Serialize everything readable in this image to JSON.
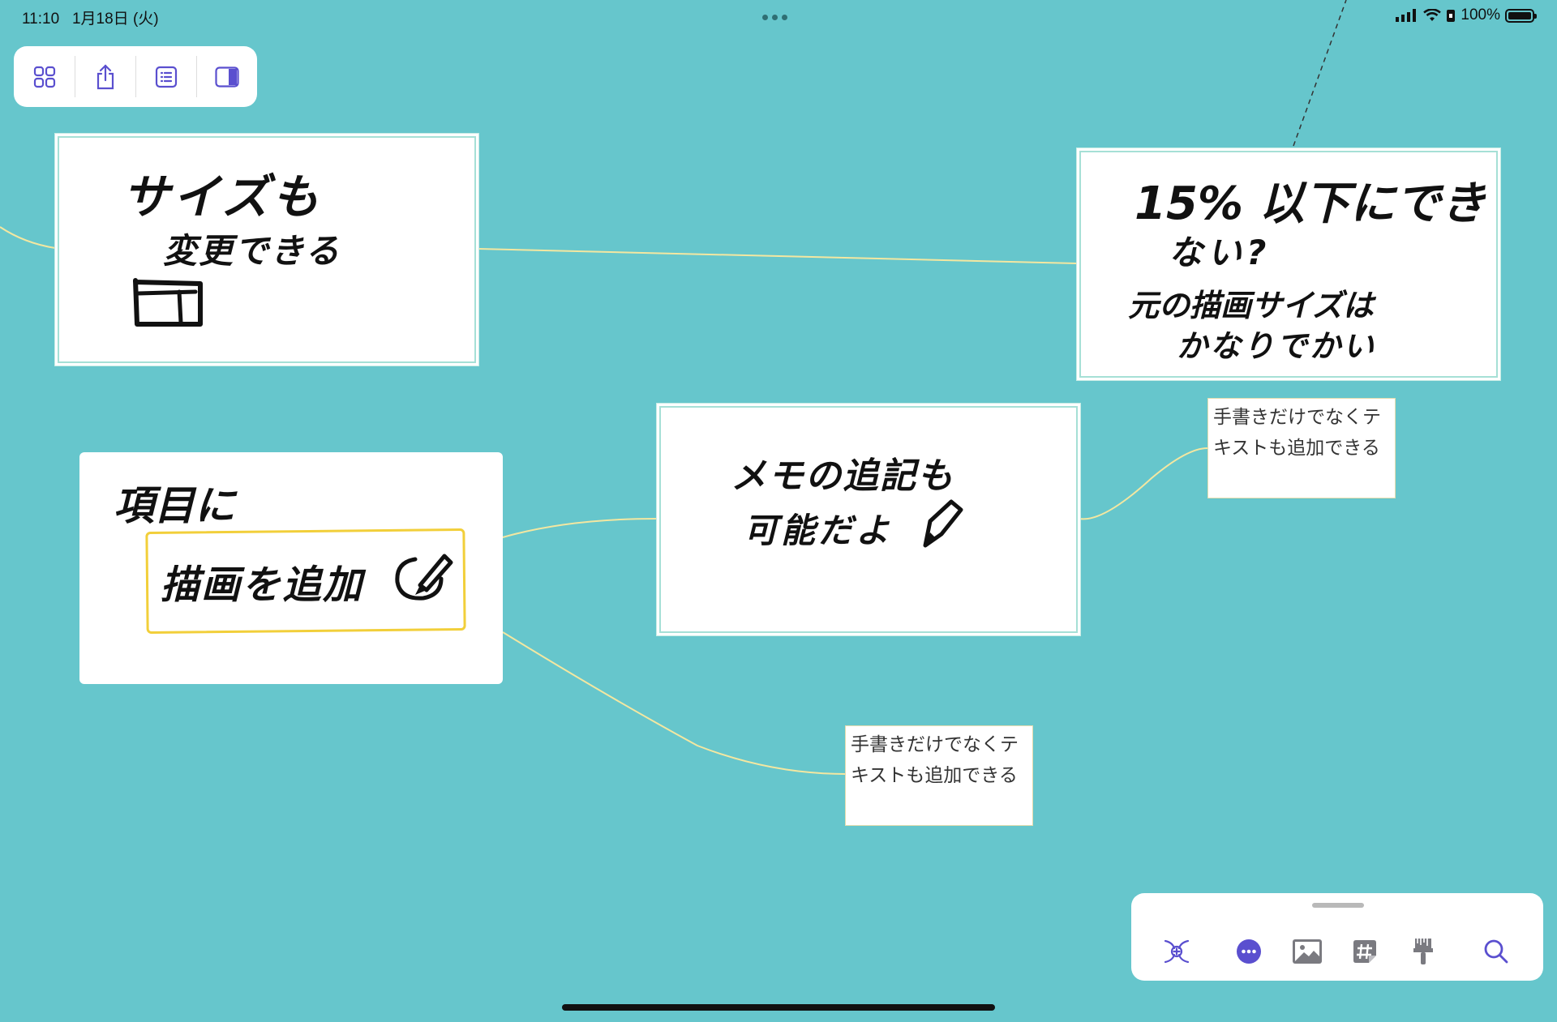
{
  "status_bar": {
    "time": "11:10",
    "date": "1月18日 (火)",
    "battery_text": "100%"
  },
  "toolbar": {
    "buttons": [
      "grid-icon",
      "share-icon",
      "outline-icon",
      "sidebar-icon"
    ]
  },
  "nodes": {
    "size": {
      "handwriting": [
        "サイズも",
        "変更できる"
      ]
    },
    "limit": {
      "handwriting": [
        "15% 以下にでき",
        "ない?",
        "元の描画サイズは",
        "かなりでかい"
      ]
    },
    "memo": {
      "handwriting": [
        "メモの追記も",
        "可能だよ"
      ]
    },
    "add": {
      "handwriting": [
        "項目に",
        "描画を追加"
      ]
    }
  },
  "notes": {
    "right": {
      "text": "手書きだけでなくテキストも追加できる"
    },
    "bottom": {
      "text": "手書きだけでなくテキストも追加できる"
    }
  },
  "bottom_panel": {
    "tools": [
      "add-topic-icon",
      "more-icon",
      "image-icon",
      "tag-icon",
      "format-icon",
      "search-icon"
    ]
  },
  "colors": {
    "background": "#66c6cc",
    "accent": "#5a4fcf",
    "link": "#f3e7a1",
    "highlight": "#f2cf3a"
  }
}
